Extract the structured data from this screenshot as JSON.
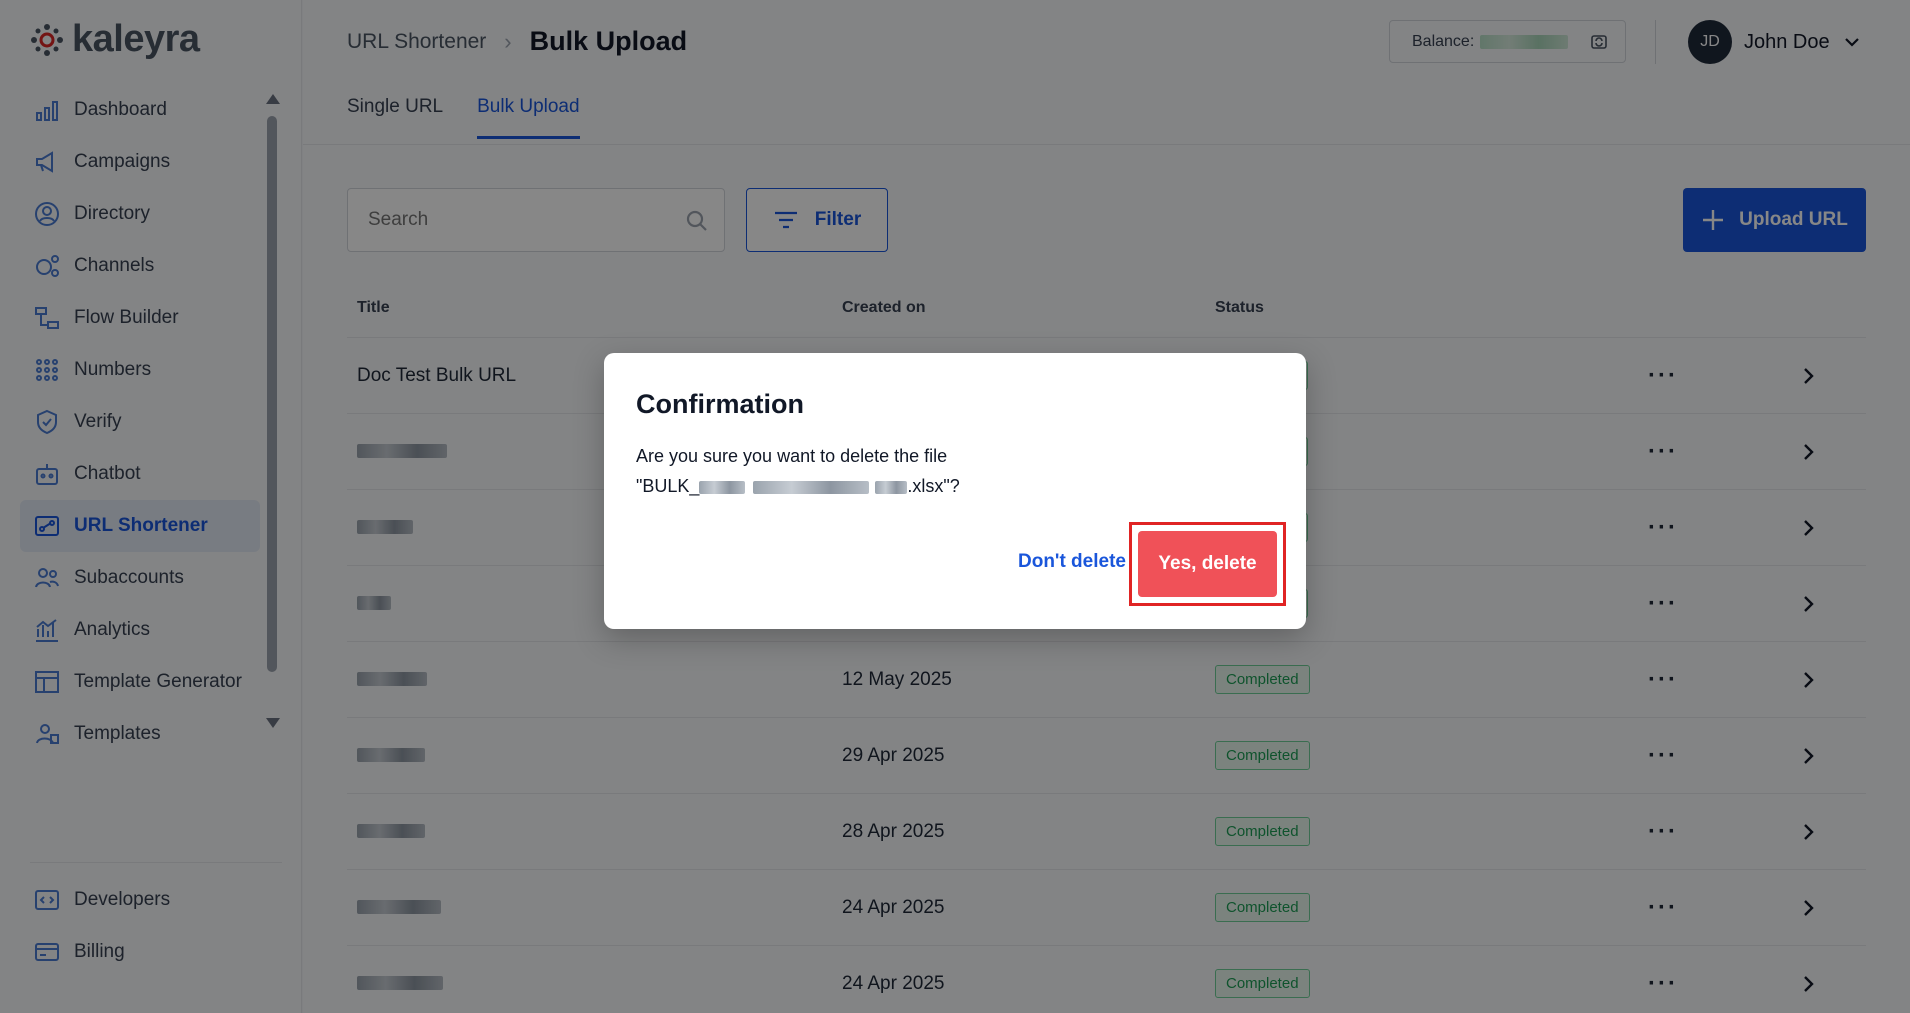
{
  "brand": {
    "name": "kaleyra"
  },
  "sidebar": {
    "items": [
      {
        "label": "Dashboard",
        "icon": "dashboard-icon"
      },
      {
        "label": "Campaigns",
        "icon": "megaphone-icon"
      },
      {
        "label": "Directory",
        "icon": "user-circle-icon"
      },
      {
        "label": "Channels",
        "icon": "channels-icon"
      },
      {
        "label": "Flow Builder",
        "icon": "flow-icon"
      },
      {
        "label": "Numbers",
        "icon": "keypad-icon"
      },
      {
        "label": "Verify",
        "icon": "shield-check-icon"
      },
      {
        "label": "Chatbot",
        "icon": "robot-icon"
      },
      {
        "label": "URL Shortener",
        "icon": "link-icon",
        "active": true
      },
      {
        "label": "Subaccounts",
        "icon": "users-icon"
      },
      {
        "label": "Analytics",
        "icon": "chart-icon"
      },
      {
        "label": "Template Generator",
        "icon": "layout-icon"
      },
      {
        "label": "Templates",
        "icon": "template-users-icon"
      }
    ],
    "bottom_items": [
      {
        "label": "Developers",
        "icon": "code-icon"
      },
      {
        "label": "Billing",
        "icon": "card-icon"
      }
    ]
  },
  "header": {
    "breadcrumb_parent": "URL Shortener",
    "breadcrumb_current": "Bulk Upload",
    "balance_label": "Balance:",
    "user_initials": "JD",
    "user_name": "John Doe"
  },
  "tabs": [
    {
      "label": "Single URL",
      "active": false
    },
    {
      "label": "Bulk Upload",
      "active": true
    }
  ],
  "toolbar": {
    "search_placeholder": "Search",
    "filter_label": "Filter",
    "upload_label": "Upload URL"
  },
  "table": {
    "columns": [
      "Title",
      "Created on",
      "Status"
    ],
    "rows": [
      {
        "title": "Doc Test Bulk URL",
        "created": "",
        "status": ""
      },
      {
        "title": "",
        "created": "",
        "status": ""
      },
      {
        "title": "",
        "created": "",
        "status": ""
      },
      {
        "title": "",
        "created": "",
        "status": ""
      },
      {
        "title": "",
        "created": "12 May 2025",
        "status": "Completed"
      },
      {
        "title": "",
        "created": "29 Apr 2025",
        "status": "Completed"
      },
      {
        "title": "",
        "created": "28 Apr 2025",
        "status": "Completed"
      },
      {
        "title": "",
        "created": "24 Apr 2025",
        "status": "Completed"
      },
      {
        "title": "",
        "created": "24 Apr 2025",
        "status": "Completed"
      }
    ]
  },
  "modal": {
    "title": "Confirmation",
    "message_line1": "Are you sure you want to delete the file",
    "file_prefix": "\"BULK_",
    "file_suffix": ".xlsx\"?",
    "cancel_label": "Don't delete",
    "confirm_label": "Yes, delete"
  },
  "colors": {
    "accent": "#1a56db",
    "danger": "#f05158",
    "success": "#1e9e55"
  }
}
